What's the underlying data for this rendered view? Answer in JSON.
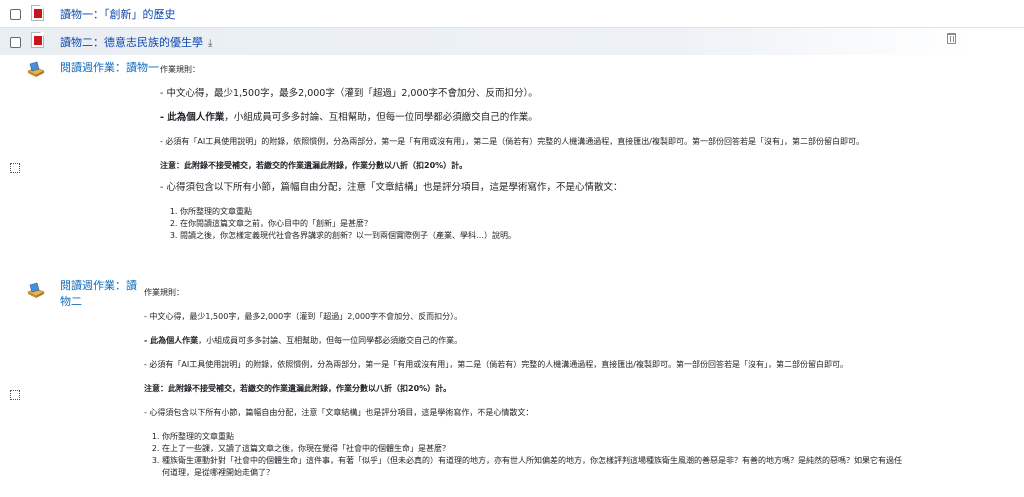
{
  "activities": [
    {
      "title": "讀物一：「創新」的歷史"
    },
    {
      "title": "讀物二：德意志民族的優生學",
      "download_icon": "download-icon"
    }
  ],
  "assignments": [
    {
      "title": "閱讀週作業：讀物一",
      "rules_heading": "作業規則：",
      "line1": "- 中文心得，最少1,500字，最多2,000字（灌到「超過」2,000字不會加分、反而扣分）。",
      "line2_bold": "- 此為個人作業",
      "line2_rest": "，小組成員可多多討論、互相幫助，但每一位同學都必須繳交自己的作業。",
      "line3": "- 必須有「AI工具使用說明」的附錄，依照慣例，分為兩部分，第一是「有用或沒有用」，第二是（倘若有）完整的人機溝通過程，直接匯出/複製即可。第一部份回答若是「沒有」，第二部份留白即可。",
      "line4": "注意：此附錄不接受補交，若繳交的作業遺漏此附錄，作業分數以八折（扣20%）計。",
      "line5": "- 心得須包含以下所有小節，篇幅自由分配，注意「文章結構」也是評分項目，這是學術寫作，不是心情散文：",
      "items": [
        "你所整理的文章重點",
        "在你閱讀這篇文章之前，你心目中的「創新」是甚麼？",
        "閱讀之後，你怎樣定義現代社會各界講求的創新？以一到兩個實際例子（產業、學科…）說明。"
      ]
    },
    {
      "title_line1": "閱讀週作業：讀",
      "title_line2": "物二",
      "rules_heading": "作業規則：",
      "line1": "- 中文心得，最少1,500字，最多2,000字（灌到「超過」2,000字不會加分、反而扣分）。",
      "line2_bold": "- 此為個人作業",
      "line2_rest": "，小組成員可多多討論、互相幫助，但每一位同學都必須繳交自己的作業。",
      "line3": "- 必須有「AI工具使用說明」的附錄，依照慣例，分為兩部分，第一是「有用或沒有用」，第二是（倘若有）完整的人機溝通過程，直接匯出/複製即可。第一部份回答若是「沒有」，第二部份留白即可。",
      "line4": "注意：此附錄不接受補交，若繳交的作業遺漏此附錄，作業分數以八折（扣20%）計。",
      "line5": "- 心得須包含以下所有小節，篇幅自由分配，注意「文章結構」也是評分項目，這是學術寫作，不是心情散文：",
      "items": [
        "你所整理的文章重點",
        "在上了一些課，又讀了這篇文章之後，你現在覺得「社會中的個體生命」是甚麼？",
        "種族衛生運動針對「社會中的個體生命」這件事，有著「似乎」（但未必真的）有道理的地方，亦有世人所知偏差的地方，你怎樣評判這場種族衛生風潮的善惡是非？有善的地方嗎？是純然的惡嗎？如果它有過任",
        "何道理，是從哪裡開始走偏了？"
      ]
    }
  ]
}
